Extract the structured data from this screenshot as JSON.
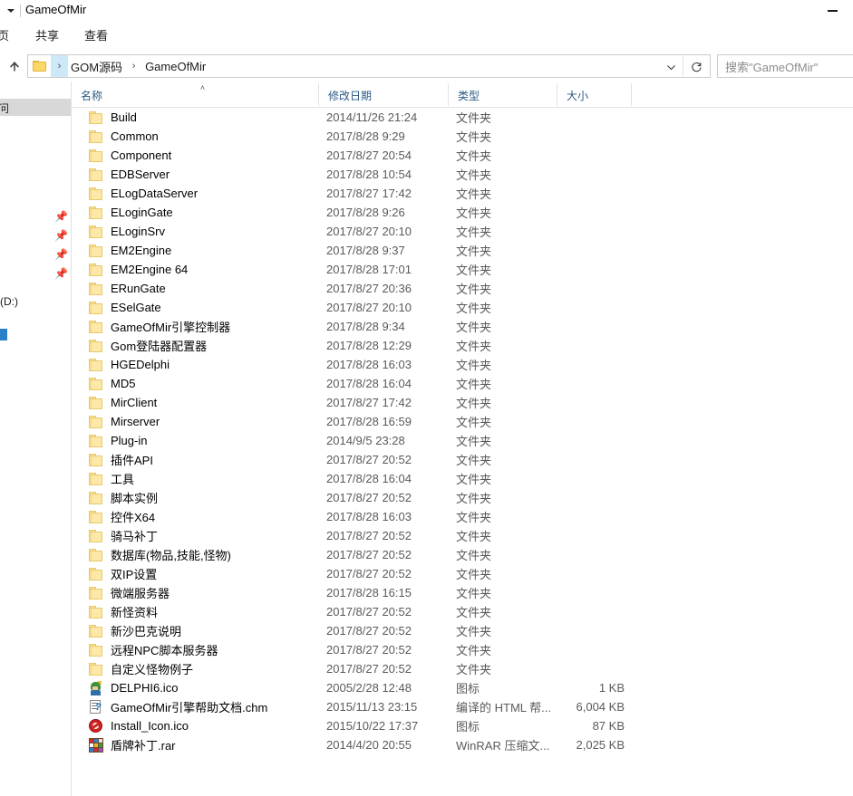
{
  "window": {
    "title": "GameOfMir",
    "quick_access_caret_icon": "chevron-down-icon",
    "minimize_label": "—"
  },
  "ribbon": {
    "tabs": [
      {
        "label": "主页"
      },
      {
        "label": "共享"
      },
      {
        "label": "查看"
      }
    ]
  },
  "address_bar": {
    "up_icon": "up-arrow-icon",
    "folder_icon": "folder-icon",
    "separator": "›",
    "crumbs": [
      {
        "label": "GOM源码"
      },
      {
        "label": "GameOfMir"
      }
    ],
    "dropdown_icon": "chevron-down-icon",
    "refresh_icon": "refresh-icon"
  },
  "search": {
    "placeholder": "搜索\"GameOfMir\"",
    "value": ""
  },
  "navigation_pane": {
    "quick_access_label": "问",
    "drive_label": "(D:)",
    "pin_icon": "pin-icon",
    "pins": [
      {
        "icon": "pin-icon"
      },
      {
        "icon": "pin-icon"
      },
      {
        "icon": "pin-icon"
      },
      {
        "icon": "pin-icon"
      }
    ]
  },
  "columns": {
    "name": "名称",
    "date_modified": "修改日期",
    "type": "类型",
    "size": "大小",
    "sort_caret": "˄",
    "sorted_by": "name",
    "sort_direction": "ascending"
  },
  "types": {
    "folder": "文件夹",
    "icon_file": "图标",
    "chm": "编译的 HTML 帮...",
    "rar": "WinRAR 压缩文..."
  },
  "files": [
    {
      "name": "Build",
      "icon": "folder-icon",
      "date": "2014/11/26 21:24",
      "type": "文件夹",
      "size": ""
    },
    {
      "name": "Common",
      "icon": "folder-icon",
      "date": "2017/8/28 9:29",
      "type": "文件夹",
      "size": ""
    },
    {
      "name": "Component",
      "icon": "folder-icon",
      "date": "2017/8/27 20:54",
      "type": "文件夹",
      "size": ""
    },
    {
      "name": "EDBServer",
      "icon": "folder-icon",
      "date": "2017/8/28 10:54",
      "type": "文件夹",
      "size": ""
    },
    {
      "name": "ELogDataServer",
      "icon": "folder-icon",
      "date": "2017/8/27 17:42",
      "type": "文件夹",
      "size": ""
    },
    {
      "name": "ELoginGate",
      "icon": "folder-icon",
      "date": "2017/8/28 9:26",
      "type": "文件夹",
      "size": ""
    },
    {
      "name": "ELoginSrv",
      "icon": "folder-icon",
      "date": "2017/8/27 20:10",
      "type": "文件夹",
      "size": ""
    },
    {
      "name": "EM2Engine",
      "icon": "folder-icon",
      "date": "2017/8/28 9:37",
      "type": "文件夹",
      "size": ""
    },
    {
      "name": "EM2Engine 64",
      "icon": "folder-icon",
      "date": "2017/8/28 17:01",
      "type": "文件夹",
      "size": ""
    },
    {
      "name": "ERunGate",
      "icon": "folder-icon",
      "date": "2017/8/27 20:36",
      "type": "文件夹",
      "size": ""
    },
    {
      "name": "ESelGate",
      "icon": "folder-icon",
      "date": "2017/8/27 20:10",
      "type": "文件夹",
      "size": ""
    },
    {
      "name": "GameOfMir引擎控制器",
      "icon": "folder-icon",
      "date": "2017/8/28 9:34",
      "type": "文件夹",
      "size": ""
    },
    {
      "name": "Gom登陆器配置器",
      "icon": "folder-icon",
      "date": "2017/8/28 12:29",
      "type": "文件夹",
      "size": ""
    },
    {
      "name": "HGEDelphi",
      "icon": "folder-icon",
      "date": "2017/8/28 16:03",
      "type": "文件夹",
      "size": ""
    },
    {
      "name": "MD5",
      "icon": "folder-icon",
      "date": "2017/8/28 16:04",
      "type": "文件夹",
      "size": ""
    },
    {
      "name": "MirClient",
      "icon": "folder-icon",
      "date": "2017/8/27 17:42",
      "type": "文件夹",
      "size": ""
    },
    {
      "name": "Mirserver",
      "icon": "folder-icon",
      "date": "2017/8/28 16:59",
      "type": "文件夹",
      "size": ""
    },
    {
      "name": "Plug-in",
      "icon": "folder-icon",
      "date": "2014/9/5 23:28",
      "type": "文件夹",
      "size": ""
    },
    {
      "name": "插件API",
      "icon": "folder-icon",
      "date": "2017/8/27 20:52",
      "type": "文件夹",
      "size": ""
    },
    {
      "name": "工具",
      "icon": "folder-icon",
      "date": "2017/8/28 16:04",
      "type": "文件夹",
      "size": ""
    },
    {
      "name": "脚本实例",
      "icon": "folder-icon",
      "date": "2017/8/27 20:52",
      "type": "文件夹",
      "size": ""
    },
    {
      "name": "控件X64",
      "icon": "folder-icon",
      "date": "2017/8/28 16:03",
      "type": "文件夹",
      "size": ""
    },
    {
      "name": "骑马补丁",
      "icon": "folder-icon",
      "date": "2017/8/27 20:52",
      "type": "文件夹",
      "size": ""
    },
    {
      "name": "数据库(物品,技能,怪物)",
      "icon": "folder-icon",
      "date": "2017/8/27 20:52",
      "type": "文件夹",
      "size": ""
    },
    {
      "name": "双IP设置",
      "icon": "folder-icon",
      "date": "2017/8/27 20:52",
      "type": "文件夹",
      "size": ""
    },
    {
      "name": "微端服务器",
      "icon": "folder-icon",
      "date": "2017/8/28 16:15",
      "type": "文件夹",
      "size": ""
    },
    {
      "name": "新怪资料",
      "icon": "folder-icon",
      "date": "2017/8/27 20:52",
      "type": "文件夹",
      "size": ""
    },
    {
      "name": "新沙巴克说明",
      "icon": "folder-icon",
      "date": "2017/8/27 20:52",
      "type": "文件夹",
      "size": ""
    },
    {
      "name": "远程NPC脚本服务器",
      "icon": "folder-icon",
      "date": "2017/8/27 20:52",
      "type": "文件夹",
      "size": ""
    },
    {
      "name": "自定义怪物例子",
      "icon": "folder-icon",
      "date": "2017/8/27 20:52",
      "type": "文件夹",
      "size": ""
    },
    {
      "name": "DELPHI6.ico",
      "icon": "delphi-icon",
      "date": "2005/2/28 12:48",
      "type": "图标",
      "size": "1 KB"
    },
    {
      "name": "GameOfMir引擎帮助文档.chm",
      "icon": "chm-help-icon",
      "date": "2015/11/13 23:15",
      "type": "编译的 HTML 帮...",
      "size": "6,004 KB"
    },
    {
      "name": "Install_Icon.ico",
      "icon": "install-icon",
      "date": "2015/10/22 17:37",
      "type": "图标",
      "size": "87 KB"
    },
    {
      "name": "盾牌补丁.rar",
      "icon": "winrar-icon",
      "date": "2014/4/20 20:55",
      "type": "WinRAR 压缩文...",
      "size": "2,025 KB"
    }
  ]
}
